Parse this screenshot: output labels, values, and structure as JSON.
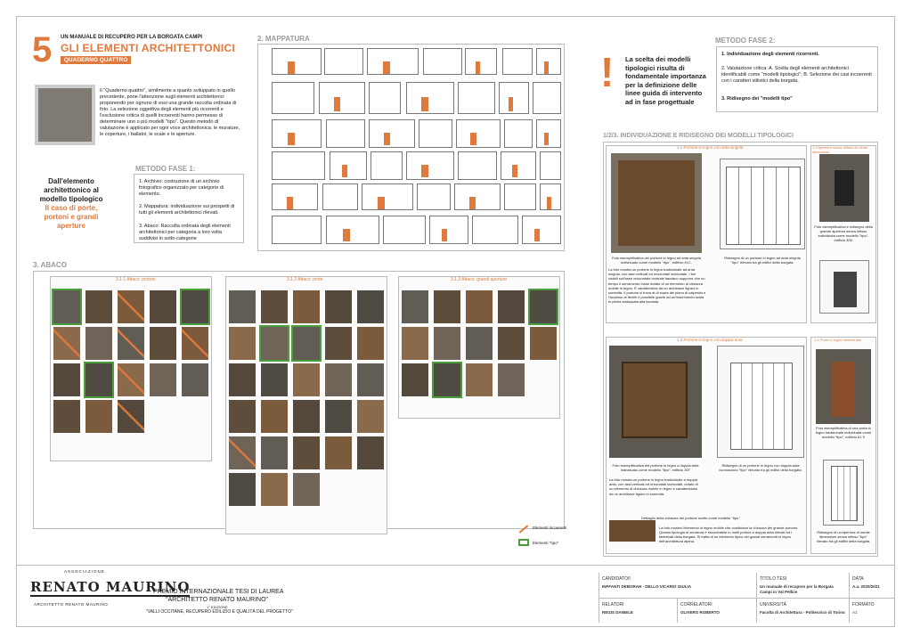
{
  "header": {
    "number": "5",
    "subtitle": "UN MANUALE DI RECUPERO PER LA BORGATA CAMPI",
    "title": "GLI ELEMENTI ARCHITETTONICI",
    "quaderno": "QUADERNO QUATTRO"
  },
  "intro": {
    "text": "Il \"Quaderno quattro\", similmente a quanto sviluppato in quello precedente, pone l'attenzione sugli elementi architettonici proponendo per ognuno di essi una grande raccolta ordinata di foto. La selezione oggettiva degli elementi più ricorrenti e l'esclusione critica di quelli incoerenti hanno permesso di determinare uno o più modelli \"tipo\". Questo metodo di valutazione è applicato per ogni voce architettonica: le murature, le coperture, i ballatoi, le scale e le aperture."
  },
  "left_panel": {
    "heading": "Dall'elemento architettonico al modello tipologico",
    "case": "Il caso di porte, portoni e grandi aperture"
  },
  "metodo1": {
    "title": "METODO FASE 1:",
    "items": [
      "1. Archivio: costruzione di un archivio fotografico organizzato per categorie di elemento.",
      "2. Mappatura: individuazione sui prospetti di tutti gli elementi architettonici rilevati.",
      "3. Abaco: Raccolta ordinata degli elementi architettonici per categoria a loro volta suddivisi in sotto-categorie"
    ]
  },
  "mappatura": {
    "title": "2. MAPPATURA"
  },
  "abaco": {
    "title": "3. ABACO",
    "groups": [
      "3.1.1 Abaco: portoni",
      "3.1.2 Abaco: porte",
      "3.1.3 Abaco: grandi aperture"
    ],
    "legend": [
      "Elementi incoerenti",
      "Elementi \"tipo\""
    ]
  },
  "callout": {
    "mark": "!",
    "text": "La scelta dei modelli tipologici risulta di fondamentale importanza per la definizione delle linee guida di intervento ad in fase progettuale"
  },
  "metodo2": {
    "title": "METODO FASE 2:",
    "items": [
      "1. Individuazione degli elementi ricorrenti.",
      "2. Valutazione critica: A. Scelta degli elementi architettonici identificabili come \"modelli tipologici\"; B. Selezione dei casi incoerenti con i caratteri stilistici della borgata.",
      "3. Ridisegno dei \"modelli tipo\""
    ]
  },
  "modelli": {
    "title": "1/2/3. INDIVIDUAZIONE E RIDISEGNO DEI MODELLI TIPOLOGICI",
    "subsections": [
      "1.1 Portone in legno con anta singola",
      "1.2 Aperture senza infisso di medie dimensioni",
      "1.3 Portone in legno con doppia anta",
      "1.4 Porta in legno tradizionale"
    ],
    "captions": [
      "Foto esemplificativa del portone in legno ad anta singola individuato come modello \"tipo\", edificio 41C.",
      "Ridisegno di un portone in legno ad anta singola \"tipo\" rilevato tra gli edifici della borgata.",
      "Foto esemplificativa e ridisegno della grande apertura senza infisso individuata come modello \"tipo\", edificio 30D",
      "Foto esemplificativa del portone in legno a doppia anta individuato come modello \"tipo\", edificio 30T",
      "Ridisegno di un portone in legno con doppia anta riconosciuto \"tipo\" rilevato tra gli edifici della borgata.",
      "Foto esemplificativa di una porta in legno tradizionale individuata come modello \"tipo\", edificio 61 S",
      "Dettaglio della chiusura del portone scelto come modello \"tipo\"",
      "Ridisegno di un'apertura di medie dimensioni senza infisso \"tipo\" rilevato tra gli edifici della borgata."
    ],
    "paragraph1": "La foto mostra un portone in legno tradizionale ad anta singola, con assi verticali ed orizzontali inchiodate. I fori visibili sull'asse orizzontale centrale lasciano supporre che un tempo il serramento fosse dotato di un elemento di chiusura mobile in legno. È caratteristica da un architrave ligneo in sommità. Il portone si trova al di sopra del piano di calpestio e l'accesso al fienile è possibile grazie ad un'inserimento scala in pietra addossata alla facciata.",
    "paragraph2": "La foto mostra un portone in legno tradizionale a doppia anta, con assi verticali ed orizzontali inchiodati, dotato di un elemento di chiusura mobile in legno e caratterizzato da un architrave ligneo in sommità.",
    "paragraph3": "La foto mostra l'elemento in legno mobile che costituisce la chiusura del grande portone. Questa tipologia di serratura è riscontrabile in molti portoni a doppia anta rilevati tra i fabbricati della borgata. Si tratta di un elemento tipico dei grandi serramenti in legno dell'architettura alpina."
  },
  "footer": {
    "assoc_small": "ASSOCIAZIONE",
    "logo": "RENATO MAURINO",
    "assoc_bottom": "ARCHITETTO RENATO MAURINO",
    "premio1": "PREMIO INTERNAZIONALE TESI DI LAUREA",
    "premio2": "\"ARCHITETTO RENATO MAURINO\"",
    "edizione": "1° EDIZIONE",
    "premio3": "\"VALLI OCCITANE, RECUPERO EDILIZIO E QUALITÀ DEL PROGETTO\"",
    "candidati_label": "CANDIDATO/I",
    "candidati": "INFFANTI DEBORAH - DELLO VICARIO GIULIA",
    "titolo_label": "TITOLO TESI",
    "titolo": "Un manuale di recupero per la Borgata Campi in Val Pellice",
    "data_label": "DATA",
    "data": "A.a. 2020/2021",
    "relatori_label": "RELATORI",
    "relatori": "REGIS DANIELE",
    "correlatori_label": "CORRELATORI",
    "correlatori": "OLIVERO ROBERTO",
    "universita_label": "UNIVERSITÀ",
    "universita": "Facoltà di Architettura - Politecnico di Torino",
    "formato_label": "FORMATO",
    "formato": "A1"
  }
}
